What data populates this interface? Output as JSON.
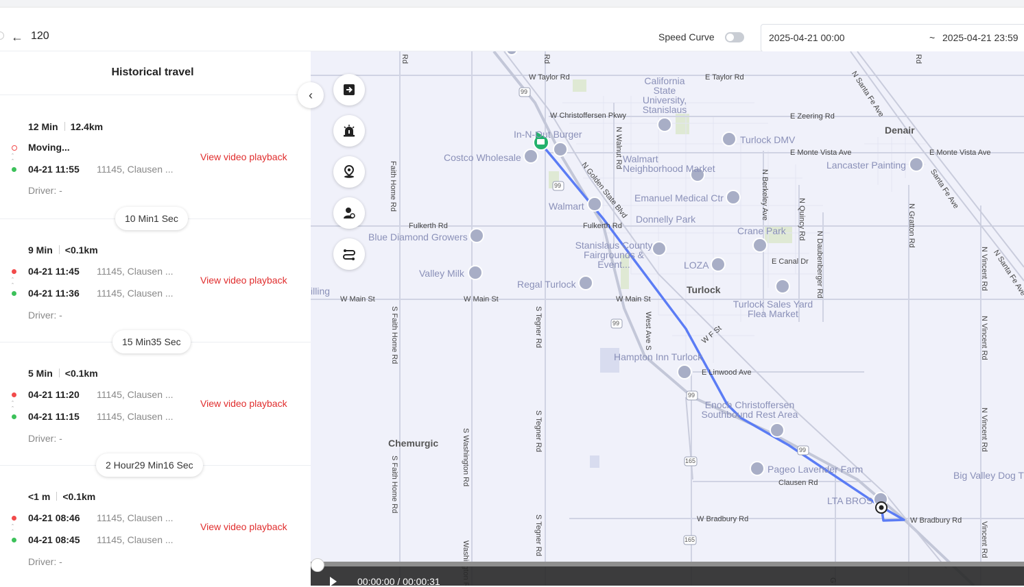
{
  "header": {
    "back_icon": "arrow-left-icon",
    "vehicle_id": "120",
    "speed_curve_label": "Speed Curve",
    "speed_curve_on": false,
    "date_start": "2025-04-21 00:00",
    "date_separator": "~",
    "date_end": "2025-04-21 23:59"
  },
  "panel": {
    "title": "Historical travel",
    "collapse_icon": "chevron-left-icon",
    "trips": [
      {
        "duration": "12 Min",
        "distance": "12.4km",
        "end_time": "Moving...",
        "start_time": "04-21 11:55",
        "start_addr": "11145, Clausen ...",
        "driver": "Driver:  -",
        "video": "View video playback"
      },
      {
        "duration": "9 Min",
        "distance": "<0.1km",
        "end_time": "04-21 11:45",
        "end_addr": "11145, Clausen ...",
        "start_time": "04-21 11:36",
        "start_addr": "11145, Clausen ...",
        "driver": "Driver:  -",
        "video": "View video playback"
      },
      {
        "duration": "5 Min",
        "distance": "<0.1km",
        "end_time": "04-21 11:20",
        "end_addr": "11145, Clausen ...",
        "start_time": "04-21 11:15",
        "start_addr": "11145, Clausen ...",
        "driver": "Driver:  -",
        "video": "View video playback"
      },
      {
        "duration": "<1 m",
        "distance": "<0.1km",
        "end_time": "04-21 08:46",
        "end_addr": "11145, Clausen ...",
        "start_time": "04-21 08:45",
        "start_addr": "11145, Clausen ...",
        "driver": "Driver:  -",
        "video": "View video playback"
      }
    ],
    "gaps": [
      "10 Min1 Sec",
      "15 Min35 Sec",
      "2 Hour29 Min16 Sec"
    ]
  },
  "map": {
    "tools": [
      "exit-icon",
      "alarm-icon",
      "location-pin-icon",
      "driver-icon",
      "route-icon"
    ],
    "route_color": "#5b7cf5",
    "place_labels": {
      "california_state_univ": "California State University, Stanislaus",
      "in_n_out": "In-N-Out Burger",
      "costco": "Costco Wholesale",
      "walmart_nm": "Walmart Neighborhood Market",
      "turlock_dmv": "Turlock DMV",
      "lancaster": "Lancaster Painting",
      "denair": "Denair",
      "emanuel": "Emanuel Medical Ctr",
      "donnelly": "Donnelly Park",
      "walmart": "Walmart",
      "crane_park": "Crane Park",
      "blue_diamond": "Blue Diamond Growers",
      "stanislaus_fair": "Stanislaus County Fairgrounds & Event...",
      "loza": "LOZA",
      "valley_milk": "Valley Milk",
      "regal": "Regal Turlock",
      "turlock": "Turlock",
      "turlock_sales": "Turlock Sales Yard Flea Market",
      "hampton": "Hampton Inn Turlock",
      "enoch": "Enoch Christoffersen Southbound Rest Area",
      "chemurgic": "Chemurgic",
      "pageo": "Pageo Lavender Farm",
      "lta_bros": "LTA BROS",
      "big_valley": "Big Valley Dog Tr",
      "illing": "illing"
    },
    "road_labels": {
      "w_taylor": "W Taylor Rd",
      "e_taylor": "E Taylor Rd",
      "w_christoffersen": "W Christoffersen Pkwy",
      "e_zeering": "E Zeering Rd",
      "e_monte_vista": "E Monte Vista Ave",
      "e_monte_vista2": "E Monte Vista Ave",
      "n_santa_fe": "N Santa Fe Ave",
      "santa_fe_ave": "Santa Fe Ave",
      "n_santa_fe2": "N Santa Fe Ave",
      "faith_home": "Faith Home Rd",
      "n_walnut": "N Walnut Rd",
      "n_golden_state": "N Golden State Blvd",
      "n_berkeley": "N Berkeley Ave",
      "n_quincy": "N Quincy Rd",
      "n_daubenberger": "N Daubenberger Rd",
      "n_gratton": "N Gratton Rd",
      "n_vincent": "N Vincent Rd",
      "n_vincent2": "N Vincent Rd",
      "n_vincent3": "N Vincent Rd",
      "fulkerth": "Fulkerth Rd",
      "fulkerth2": "Fulkerth Rd",
      "e_canal": "E Canal Dr",
      "w_main": "W Main St",
      "w_main2": "W Main St",
      "w_main3": "W Main St",
      "s_faith_home": "S Faith Home Rd",
      "s_faith_home2": "S Faith Home Rd",
      "s_tegner": "S Tegner Rd",
      "s_tegner2": "S Tegner Rd",
      "s_tegner3": "S Tegner Rd",
      "s_washington": "S Washington Rd",
      "s_washington2": "Washington Rd",
      "west_ave_s": "West Ave S",
      "w_f_st": "W F St",
      "e_linwood": "E Linwood Ave",
      "clausen": "Clausen Rd",
      "w_bradbury": "W Bradbury Rd",
      "w_bradbury2": "W Bradbury Rd",
      "vincent_rd": "Vincent Rd",
      "rd_top1": "Rd",
      "rd_top2": "Rd",
      "rd_top3": "Rd",
      "g_bottom": "G"
    },
    "shields": [
      "99",
      "99",
      "99",
      "99",
      "99",
      "165",
      "165"
    ]
  },
  "playback": {
    "play_icon": "play-icon",
    "time": "00:00:00 / 00:00:31"
  }
}
